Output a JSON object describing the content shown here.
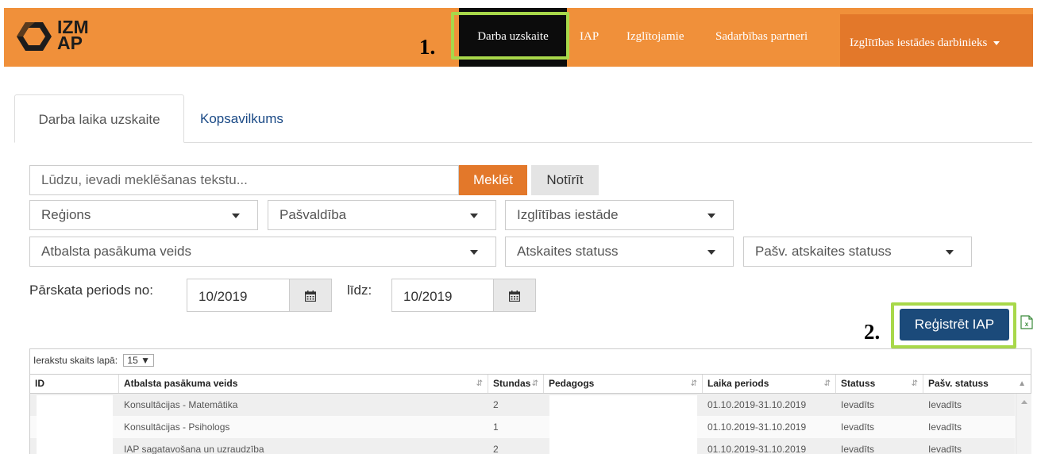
{
  "brand": {
    "logo_line1": "IZM",
    "logo_line2": "AP"
  },
  "nav": {
    "items": [
      "Darba uzskaite",
      "IAP",
      "Izglītojamie",
      "Sadarbības partneri"
    ],
    "user_menu": "Izglītības iestādes darbinieks"
  },
  "annotations": {
    "marker1": "1.",
    "marker2": "2.",
    "highlight_color": "#a8d84a"
  },
  "tabs": [
    "Darba laika uzskaite",
    "Kopsavilkums"
  ],
  "search": {
    "placeholder": "Lūdzu, ievadi meklēšanas tekstu...",
    "search_label": "Meklēt",
    "clear_label": "Notīrīt"
  },
  "filters": {
    "region": "Reģions",
    "municipality": "Pašvaldība",
    "institution": "Izglītības iestāde",
    "support_type": "Atbalsta pasākuma veids",
    "report_status": "Atskaites statuss",
    "municipal_status": "Pašv. atskaites statuss"
  },
  "period": {
    "from_label": "Pārskata periods no:",
    "from_value": "10/2019",
    "to_label": "līdz:",
    "to_value": "10/2019"
  },
  "actions": {
    "register_label": "Reģistrēt IAP",
    "export_icon": "excel-icon"
  },
  "table": {
    "page_size_label": "Ierakstu skaits lapā:",
    "page_size": "15",
    "columns": [
      "ID",
      "Atbalsta pasākuma veids",
      "Stundas",
      "Pedagogs",
      "Laika periods",
      "Statuss",
      "Pašv. statuss"
    ],
    "rows": [
      {
        "id": "",
        "type": "Konsultācijas - Matemātika",
        "hours": "2",
        "teacher": "",
        "period": "01.10.2019-31.10.2019",
        "status": "Ievadīts",
        "mun_status": "Ievadīts"
      },
      {
        "id": "",
        "type": "Konsultācijas - Psihologs",
        "hours": "1",
        "teacher": "",
        "period": "01.10.2019-31.10.2019",
        "status": "Ievadīts",
        "mun_status": "Ievadīts"
      },
      {
        "id": "",
        "type": "IAP sagatavošana un uzraudzība",
        "hours": "2",
        "teacher": "",
        "period": "01.10.2019-31.10.2019",
        "status": "Ievadīts",
        "mun_status": "Ievadīts"
      }
    ]
  },
  "colors": {
    "brand_orange": "#f0903a",
    "accent_orange": "#e3782a",
    "nav_active": "#0c0c0c",
    "primary_blue": "#1b4a7a"
  }
}
